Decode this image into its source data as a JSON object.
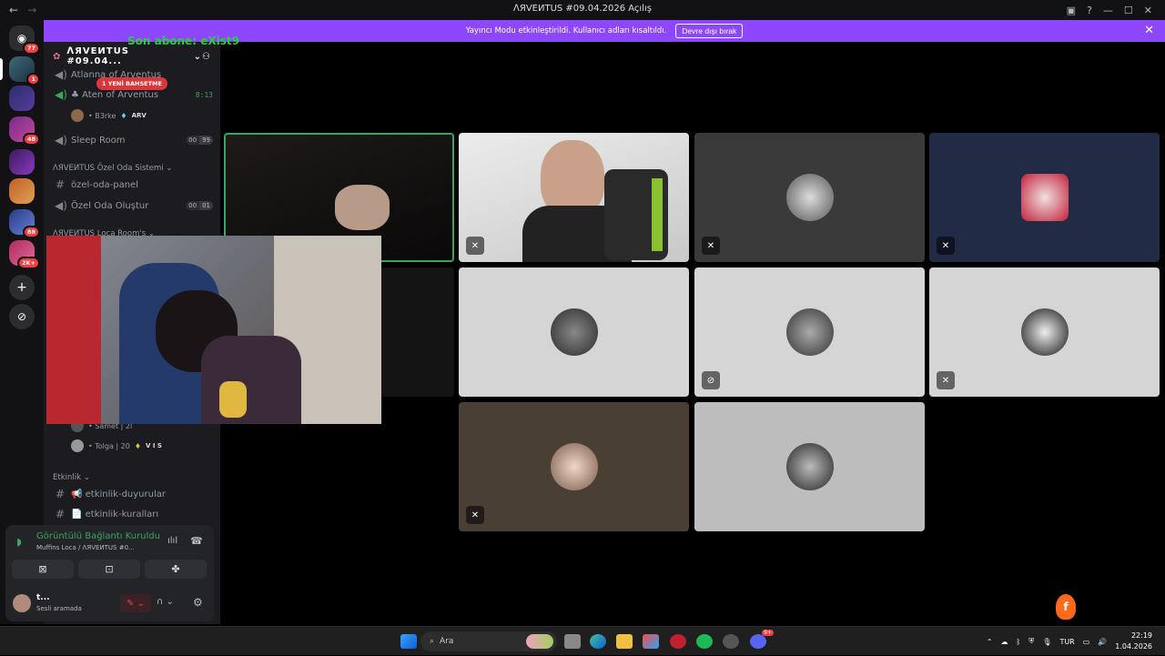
{
  "window": {
    "title": "ᐱЯVEИTUS #09.04.2026 Açılış",
    "back": "←",
    "forward": "→",
    "controls": [
      "—",
      "☐",
      "✕"
    ]
  },
  "banner": {
    "message": "Yayıncı Modu etkinleştirildi. Kullanıcı adları kısaltıldı.",
    "button": "Devre dışı bırak",
    "close": "✕"
  },
  "overlay": {
    "text": "Son abone: eXist9"
  },
  "guilds": {
    "home_badge": "77",
    "badges": [
      "1",
      "48",
      "88",
      "2K+"
    ]
  },
  "server": {
    "name": "ᐱЯVEИTUS #09.04...",
    "mention": "1 YENİ BAHSETME",
    "channels": {
      "atlanna": "Atlanna of Arventus",
      "aten": "♣ Aten of Arventus",
      "aten_time": "8:13",
      "b3rke": "• B3rke",
      "b3rke_tag": "ARV",
      "sleep": "Sleep Room",
      "sleep_counts": [
        "00",
        "99"
      ],
      "cat_ozel": "ᐱЯVEИTUS Özel Oda Sistemi",
      "ozel_panel": "özel-oda-panel",
      "ozel_olustur": "Özel Oda Oluştur",
      "olustur_counts": [
        "00",
        "01"
      ],
      "cat_loca": "ᐱЯVEИTUS Loca Room's",
      "samet": "• Samet | 2l",
      "tolga": "• Tolga | 20",
      "tolga_tag": "V I S",
      "cat_etkinlik": "Etkinlik",
      "duyurular": "📢 etkinlik-duyurular",
      "kurallari": "📄 etkinlik-kuralları"
    }
  },
  "voice": {
    "status": "Görüntülü Bağlantı Kuruldu",
    "channel": "Muffins Loca / ᐱЯVEИTUS #0...",
    "user_name": "t...",
    "user_status": "Sesli aramada"
  },
  "taskbar": {
    "search": "Ara",
    "lang": "TUR",
    "time": "22:19",
    "date": "1.04.2026",
    "discord_badge": "9+"
  },
  "colors": {
    "brand": "#8c47ff",
    "connected": "#3ba55d",
    "danger": "#f23f43"
  }
}
